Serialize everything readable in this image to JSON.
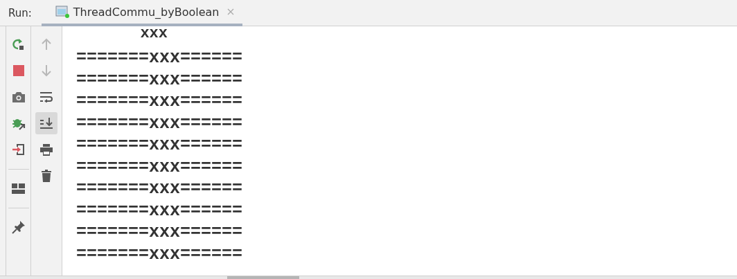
{
  "run_panel": {
    "label": "Run:",
    "tabs": [
      {
        "title": "ThreadCommu_byBoolean",
        "selected": true
      }
    ]
  },
  "left_toolbar": [
    {
      "kind": "rerun"
    },
    {
      "kind": "stop"
    },
    {
      "kind": "camera"
    },
    {
      "kind": "debug"
    },
    {
      "kind": "exit"
    },
    {
      "kind": "separator"
    },
    {
      "kind": "layout"
    },
    {
      "kind": "separator"
    },
    {
      "kind": "pin"
    }
  ],
  "console_toolbar": [
    {
      "kind": "up",
      "disabled": true,
      "selected": false
    },
    {
      "kind": "down",
      "disabled": true,
      "selected": false
    },
    {
      "kind": "wrap",
      "disabled": false,
      "selected": false
    },
    {
      "kind": "scroll-end",
      "disabled": false,
      "selected": true
    },
    {
      "kind": "print",
      "disabled": false,
      "selected": false
    },
    {
      "kind": "trash",
      "disabled": false,
      "selected": false
    }
  ],
  "console_lines": [
    "       xxx",
    "=======xxx======",
    "=======xxx======",
    "=======xxx======",
    "=======xxx======",
    "=======xxx======",
    "=======xxx======",
    "=======xxx======",
    "=======xxx======",
    "=======xxx======",
    "=======xxx======"
  ]
}
